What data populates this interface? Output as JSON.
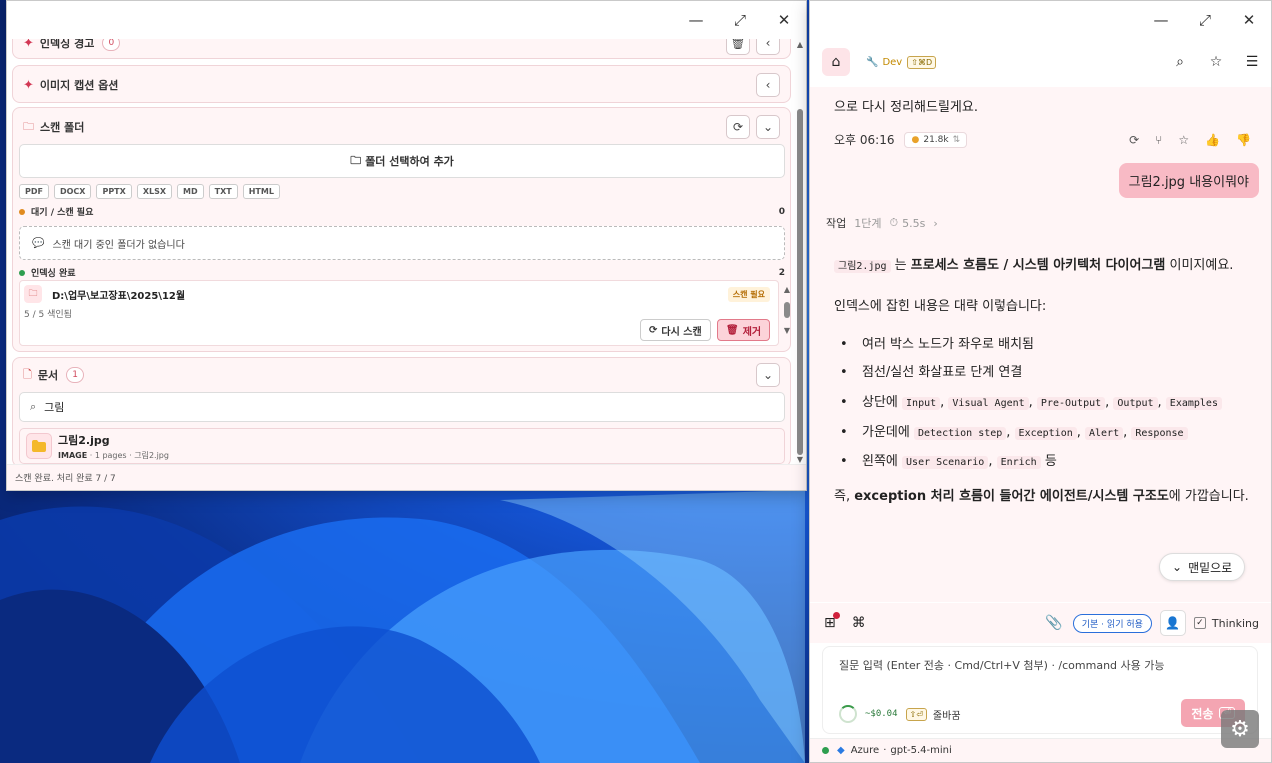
{
  "left_window": {
    "title_controls": {
      "minimize": "—",
      "maximize": "⤢",
      "close": "✕"
    },
    "indexing_warning": {
      "title": "인덱싱 경고",
      "count": "0"
    },
    "caption_options": {
      "title": "이미지 캡션 옵션"
    },
    "scan_folder": {
      "title": "스캔 폴더",
      "add_folder_label": "폴더 선택하여 추가",
      "file_types": [
        "PDF",
        "DOCX",
        "PPTX",
        "XLSX",
        "MD",
        "TXT",
        "HTML"
      ],
      "pending": {
        "label": "대기 / 스캔 필요",
        "count": "0",
        "empty_text": "스캔 대기 중인 폴더가 없습니다"
      },
      "done": {
        "label": "인덱싱 완료",
        "count": "2"
      },
      "item": {
        "path": "D:\\업무\\보고장표\\2025\\12월",
        "sub": "5 / 5 색인됨",
        "badge": "스캔 필요",
        "rescan_label": "다시 스캔",
        "remove_label": "제거"
      }
    },
    "documents": {
      "title": "문서",
      "count": "1",
      "search_value": "그림",
      "item": {
        "name": "그림2.jpg",
        "type": "IMAGE",
        "pages": "1 pages",
        "file": "그림2.jpg"
      }
    },
    "status_text": "스캔 완료. 처리 완료 7 / 7"
  },
  "right_window": {
    "title_controls": {
      "minimize": "—",
      "maximize": "⤢",
      "close": "✕"
    },
    "header": {
      "dev_label": "Dev",
      "shortcut": "⇧⌘D"
    },
    "chat": {
      "prev_text": "으로 다시 정리해드릴게요.",
      "time": "오후 06:16",
      "tokens": "21.8k",
      "user_message": "그림2.jpg 내용이뭐야",
      "step_label": "작업",
      "step_count": "1단계",
      "step_time": "5.5s",
      "answer": {
        "p1_code": "그림2.jpg",
        "p1_mid": " 는 ",
        "p1_bold": "프로세스 흐름도 / 시스템 아키텍처 다이어그램",
        "p1_tail": " 이미지예요.",
        "p2": "인덱스에 잡힌 내용은 대략 이렇습니다:",
        "bullet1": "여러 박스 노드가 좌우로 배치됨",
        "bullet2": "점선/실선 화살표로 단계 연결",
        "bullet3_prefix": "상단에",
        "bullet3_codes": [
          "Input",
          "Visual Agent",
          "Pre-Output",
          "Output",
          "Examples"
        ],
        "bullet4_prefix": "가운데에",
        "bullet4_codes": [
          "Detection step",
          "Exception",
          "Alert",
          "Response"
        ],
        "bullet5_prefix": "왼쪽에",
        "bullet5_codes": [
          "User Scenario",
          "Enrich"
        ],
        "bullet5_suffix": "등",
        "p3_prefix": "즉, ",
        "p3_bold": "exception 처리 흐름이 들어간 에이전트/시스템 구조도",
        "p3_tail": "에 가깝습니다."
      },
      "scroll_bottom_label": "맨밑으로"
    },
    "composer": {
      "permission": "기본 · 읽기 허용",
      "thinking_label": "Thinking",
      "placeholder": "질문 입력 (Enter 전송 · Cmd/Ctrl+V 첨부) · /command 사용 가능",
      "cost": "~$0.04",
      "newline_kbd": "⇧⏎",
      "newline_label": "줄바꿈",
      "send_label": "전송",
      "send_kbd": "⏎"
    },
    "status": {
      "provider": "Azure",
      "model": "gpt-5.4-mini",
      "separator": "·"
    }
  },
  "colors": {
    "accent_pink": "#f4a5b2",
    "card_bg": "#fff5f6",
    "link_blue": "#2a6fdb"
  }
}
